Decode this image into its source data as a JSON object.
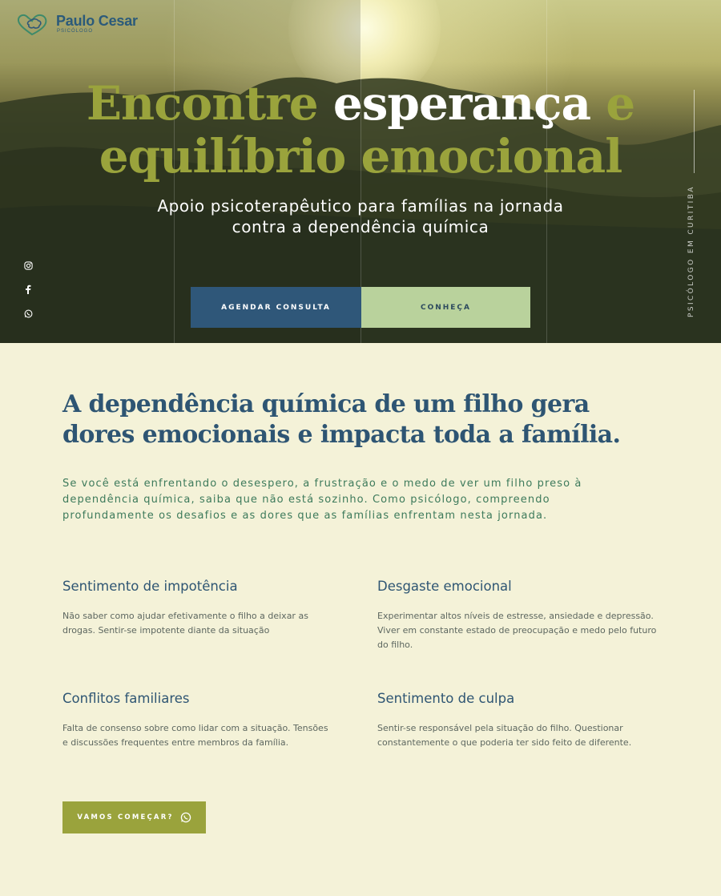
{
  "brand": {
    "name": "Paulo Cesar",
    "subtitle": "PSICÓLOGO"
  },
  "hero": {
    "title_part1": "Encontre ",
    "title_highlight": "esperança",
    "title_part2": " e equilíbrio emocional",
    "subtitle": "Apoio psicoterapêutico para famílias na jornada contra a dependência química",
    "vertical_tag": "PSICÓLOGO EM CURITIBA",
    "primary_button": "AGENDAR CONSULTA",
    "secondary_button": "CONHEÇA"
  },
  "social": [
    "instagram-icon",
    "facebook-icon",
    "whatsapp-icon"
  ],
  "section": {
    "title": "A dependência química de um filho gera dores emocionais e impacta toda a família.",
    "intro": "Se você está enfrentando o desespero, a frustração e o medo de ver um filho preso à dependência química, saiba que não está sozinho. Como psicólogo, compreendo profundamente os desafios e as dores que as famílias enfrentam nesta jornada.",
    "cards": [
      {
        "title": "Sentimento de impotência",
        "text": "Não saber como ajudar efetivamente o filho a deixar as drogas. Sentir-se impotente diante da situação"
      },
      {
        "title": "Desgaste emocional",
        "text": "Experimentar altos níveis de estresse, ansiedade e depressão. Viver em constante estado de preocupação e medo pelo futuro do filho."
      },
      {
        "title": "Conflitos familiares",
        "text": "Falta de consenso sobre como lidar com a situação. Tensões e discussões frequentes entre membros da família."
      },
      {
        "title": "Sentimento de culpa",
        "text": "Sentir-se responsável pela situação do filho. Questionar constantemente o que poderia ter sido feito de diferente."
      }
    ],
    "cta": "VAMOS COMEÇAR?"
  },
  "colors": {
    "primary": "#2f5779",
    "accent": "#9aa33c",
    "light": "#b9d29c",
    "background": "#f4f2d8"
  }
}
